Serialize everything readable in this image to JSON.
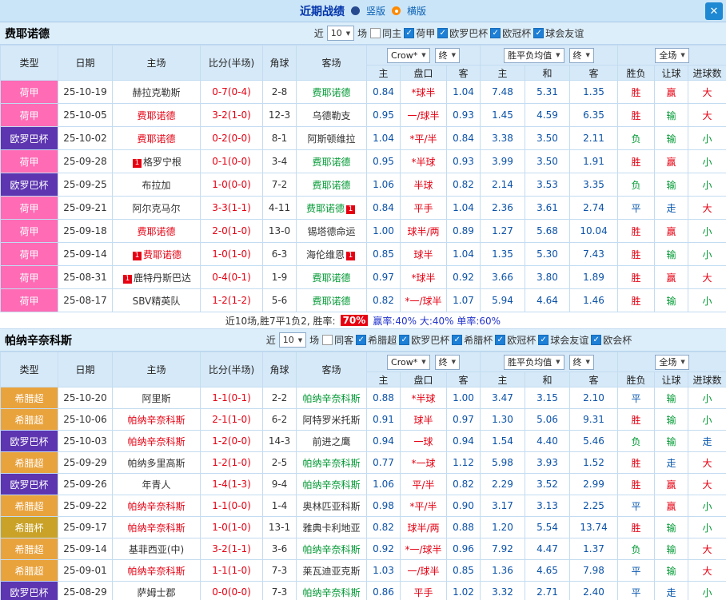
{
  "topbar": {
    "title": "近期战绩",
    "radios": [
      {
        "label": "竖版",
        "selected": false
      },
      {
        "label": "横版",
        "selected": true
      }
    ],
    "close_icon": "✕"
  },
  "table_header": {
    "type": "类型",
    "date": "日期",
    "home": "主场",
    "score": "比分(半场)",
    "corner": "角球",
    "away": "客场",
    "odds_source": "Crow*",
    "odds_time": "终",
    "avg_source": "胜平负均值",
    "avg_time": "终",
    "scope": "全场",
    "sub_home": "主",
    "sub_handicap": "盘口",
    "sub_away": "客",
    "sub_avg_home": "主",
    "sub_avg_draw": "和",
    "sub_avg_away": "客",
    "sub_result": "胜负",
    "sub_handicap_result": "让球",
    "sub_goals": "进球数",
    "dropdown_arrow": "▼"
  },
  "colors": {
    "league_eredivisie": "#ff6bb5",
    "league_europa": "#5d35b0",
    "league_greek_super": "#e9a33d",
    "league_greek_cup": "#c9a227",
    "win_red": "#e60012",
    "lose_green": "#009933",
    "draw_blue": "#0a58b0",
    "odds_blue": "#0b52a8",
    "accent_close": "#1e88d2",
    "selected_radio_orange": "#ff8a00"
  },
  "sections": [
    {
      "team": "费耶诺德",
      "filters": {
        "near": "近",
        "count": "10",
        "games": "场",
        "checkboxes": [
          {
            "label": "同主",
            "checked": false
          },
          {
            "label": "荷甲",
            "checked": true
          },
          {
            "label": "欧罗巴杯",
            "checked": true
          },
          {
            "label": "欧冠杯",
            "checked": true
          },
          {
            "label": "球会友谊",
            "checked": true
          }
        ]
      },
      "rows": [
        {
          "league": "荷甲",
          "lc": "nl",
          "date": "25-10-19",
          "home": {
            "name": "赫拉克勒斯",
            "color": "",
            "pre": "",
            "post": ""
          },
          "score": "0-7(0-4)",
          "corner": "2-8",
          "away": {
            "name": "费耶诺德",
            "color": "green",
            "pre": "",
            "post": ""
          },
          "odds": [
            "0.84",
            "*球半",
            "1.04"
          ],
          "avg": [
            "7.48",
            "5.31",
            "1.35"
          ],
          "res": [
            [
              "胜",
              "r"
            ],
            [
              "赢",
              "r"
            ],
            [
              "大",
              "r"
            ]
          ]
        },
        {
          "league": "荷甲",
          "lc": "nl",
          "date": "25-10-05",
          "home": {
            "name": "费耶诺德",
            "color": "red",
            "pre": "",
            "post": ""
          },
          "score": "3-2(1-0)",
          "corner": "12-3",
          "away": {
            "name": "乌德勒支",
            "color": "",
            "pre": "",
            "post": ""
          },
          "odds": [
            "0.95",
            "一/球半",
            "0.93"
          ],
          "avg": [
            "1.45",
            "4.59",
            "6.35"
          ],
          "res": [
            [
              "胜",
              "r"
            ],
            [
              "输",
              "g"
            ],
            [
              "大",
              "r"
            ]
          ]
        },
        {
          "league": "欧罗巴杯",
          "lc": "uel",
          "date": "25-10-02",
          "home": {
            "name": "费耶诺德",
            "color": "red",
            "pre": "",
            "post": ""
          },
          "score": "0-2(0-0)",
          "corner": "8-1",
          "away": {
            "name": "阿斯顿维拉",
            "color": "",
            "pre": "",
            "post": ""
          },
          "odds": [
            "1.04",
            "*平/半",
            "0.84"
          ],
          "avg": [
            "3.38",
            "3.50",
            "2.11"
          ],
          "res": [
            [
              "负",
              "g"
            ],
            [
              "输",
              "g"
            ],
            [
              "小",
              "g"
            ]
          ]
        },
        {
          "league": "荷甲",
          "lc": "nl",
          "date": "25-09-28",
          "home": {
            "name": "格罗宁根",
            "color": "",
            "pre": "1",
            "post": ""
          },
          "score": "0-1(0-0)",
          "corner": "3-4",
          "away": {
            "name": "费耶诺德",
            "color": "green",
            "pre": "",
            "post": ""
          },
          "odds": [
            "0.95",
            "*半球",
            "0.93"
          ],
          "avg": [
            "3.99",
            "3.50",
            "1.91"
          ],
          "res": [
            [
              "胜",
              "r"
            ],
            [
              "赢",
              "r"
            ],
            [
              "小",
              "g"
            ]
          ]
        },
        {
          "league": "欧罗巴杯",
          "lc": "uel",
          "date": "25-09-25",
          "home": {
            "name": "布拉加",
            "color": "",
            "pre": "",
            "post": ""
          },
          "score": "1-0(0-0)",
          "corner": "7-2",
          "away": {
            "name": "费耶诺德",
            "color": "green",
            "pre": "",
            "post": ""
          },
          "odds": [
            "1.06",
            "半球",
            "0.82"
          ],
          "avg": [
            "2.14",
            "3.53",
            "3.35"
          ],
          "res": [
            [
              "负",
              "g"
            ],
            [
              "输",
              "g"
            ],
            [
              "小",
              "g"
            ]
          ]
        },
        {
          "league": "荷甲",
          "lc": "nl",
          "date": "25-09-21",
          "home": {
            "name": "阿尔克马尔",
            "color": "",
            "pre": "",
            "post": ""
          },
          "score": "3-3(1-1)",
          "corner": "4-11",
          "away": {
            "name": "费耶诺德",
            "color": "green",
            "pre": "",
            "post": "1"
          },
          "odds": [
            "0.84",
            "平手",
            "1.04"
          ],
          "avg": [
            "2.36",
            "3.61",
            "2.74"
          ],
          "res": [
            [
              "平",
              "b"
            ],
            [
              "走",
              "b"
            ],
            [
              "大",
              "r"
            ]
          ]
        },
        {
          "league": "荷甲",
          "lc": "nl",
          "date": "25-09-18",
          "home": {
            "name": "费耶诺德",
            "color": "red",
            "pre": "",
            "post": ""
          },
          "score": "2-0(1-0)",
          "corner": "13-0",
          "away": {
            "name": "锡塔德命运",
            "color": "",
            "pre": "",
            "post": ""
          },
          "odds": [
            "1.00",
            "球半/两",
            "0.89"
          ],
          "avg": [
            "1.27",
            "5.68",
            "10.04"
          ],
          "res": [
            [
              "胜",
              "r"
            ],
            [
              "赢",
              "r"
            ],
            [
              "小",
              "g"
            ]
          ]
        },
        {
          "league": "荷甲",
          "lc": "nl",
          "date": "25-09-14",
          "home": {
            "name": "费耶诺德",
            "color": "red",
            "pre": "1",
            "post": ""
          },
          "score": "1-0(1-0)",
          "corner": "6-3",
          "away": {
            "name": "海伦维恩",
            "color": "",
            "pre": "",
            "post": "1"
          },
          "odds": [
            "0.85",
            "球半",
            "1.04"
          ],
          "avg": [
            "1.35",
            "5.30",
            "7.43"
          ],
          "res": [
            [
              "胜",
              "r"
            ],
            [
              "输",
              "g"
            ],
            [
              "小",
              "g"
            ]
          ]
        },
        {
          "league": "荷甲",
          "lc": "nl",
          "date": "25-08-31",
          "home": {
            "name": "鹿特丹斯巴达",
            "color": "",
            "pre": "1",
            "post": ""
          },
          "score": "0-4(0-1)",
          "corner": "1-9",
          "away": {
            "name": "费耶诺德",
            "color": "green",
            "pre": "",
            "post": ""
          },
          "odds": [
            "0.97",
            "*球半",
            "0.92"
          ],
          "avg": [
            "3.66",
            "3.80",
            "1.89"
          ],
          "res": [
            [
              "胜",
              "r"
            ],
            [
              "赢",
              "r"
            ],
            [
              "大",
              "r"
            ]
          ]
        },
        {
          "league": "荷甲",
          "lc": "nl",
          "date": "25-08-17",
          "home": {
            "name": "SBV精英队",
            "color": "",
            "pre": "",
            "post": ""
          },
          "score": "1-2(1-2)",
          "corner": "5-6",
          "away": {
            "name": "费耶诺德",
            "color": "green",
            "pre": "",
            "post": ""
          },
          "odds": [
            "0.82",
            "*一/球半",
            "1.07"
          ],
          "avg": [
            "5.94",
            "4.64",
            "1.46"
          ],
          "res": [
            [
              "胜",
              "r"
            ],
            [
              "输",
              "g"
            ],
            [
              "小",
              "g"
            ]
          ]
        }
      ],
      "summary": {
        "prefix": "近10场,胜7平1负2, 胜率:",
        "win_rate": "70%",
        "stats": "赢率:40% 大:40% 单率:60%"
      }
    },
    {
      "team": "帕纳辛奈科斯",
      "filters": {
        "near": "近",
        "count": "10",
        "games": "场",
        "checkboxes": [
          {
            "label": "同客",
            "checked": false
          },
          {
            "label": "希腊超",
            "checked": true
          },
          {
            "label": "欧罗巴杯",
            "checked": true
          },
          {
            "label": "希腊杯",
            "checked": true
          },
          {
            "label": "欧冠杯",
            "checked": true
          },
          {
            "label": "球会友谊",
            "checked": true
          },
          {
            "label": "欧会杯",
            "checked": true
          }
        ]
      },
      "rows": [
        {
          "league": "希腊超",
          "lc": "gsl",
          "date": "25-10-20",
          "home": {
            "name": "阿里斯",
            "color": "",
            "pre": "",
            "post": ""
          },
          "score": "1-1(0-1)",
          "corner": "2-2",
          "away": {
            "name": "帕纳辛奈科斯",
            "color": "green",
            "pre": "",
            "post": ""
          },
          "odds": [
            "0.88",
            "*半球",
            "1.00"
          ],
          "avg": [
            "3.47",
            "3.15",
            "2.10"
          ],
          "res": [
            [
              "平",
              "b"
            ],
            [
              "输",
              "g"
            ],
            [
              "小",
              "g"
            ]
          ]
        },
        {
          "league": "希腊超",
          "lc": "gsl",
          "date": "25-10-06",
          "home": {
            "name": "帕纳辛奈科斯",
            "color": "red",
            "pre": "",
            "post": ""
          },
          "score": "2-1(1-0)",
          "corner": "6-2",
          "away": {
            "name": "阿特罗米托斯",
            "color": "",
            "pre": "",
            "post": ""
          },
          "odds": [
            "0.91",
            "球半",
            "0.97"
          ],
          "avg": [
            "1.30",
            "5.06",
            "9.31"
          ],
          "res": [
            [
              "胜",
              "r"
            ],
            [
              "输",
              "g"
            ],
            [
              "小",
              "g"
            ]
          ]
        },
        {
          "league": "欧罗巴杯",
          "lc": "uel",
          "date": "25-10-03",
          "home": {
            "name": "帕纳辛奈科斯",
            "color": "red",
            "pre": "",
            "post": ""
          },
          "score": "1-2(0-0)",
          "corner": "14-3",
          "away": {
            "name": "前进之鹰",
            "color": "",
            "pre": "",
            "post": ""
          },
          "odds": [
            "0.94",
            "一球",
            "0.94"
          ],
          "avg": [
            "1.54",
            "4.40",
            "5.46"
          ],
          "res": [
            [
              "负",
              "g"
            ],
            [
              "输",
              "g"
            ],
            [
              "走",
              "b"
            ]
          ]
        },
        {
          "league": "希腊超",
          "lc": "gsl",
          "date": "25-09-29",
          "home": {
            "name": "帕纳多里高斯",
            "color": "",
            "pre": "",
            "post": ""
          },
          "score": "1-2(1-0)",
          "corner": "2-5",
          "away": {
            "name": "帕纳辛奈科斯",
            "color": "green",
            "pre": "",
            "post": ""
          },
          "odds": [
            "0.77",
            "*一球",
            "1.12"
          ],
          "avg": [
            "5.98",
            "3.93",
            "1.52"
          ],
          "res": [
            [
              "胜",
              "r"
            ],
            [
              "走",
              "b"
            ],
            [
              "大",
              "r"
            ]
          ]
        },
        {
          "league": "欧罗巴杯",
          "lc": "uel",
          "date": "25-09-26",
          "home": {
            "name": "年青人",
            "color": "",
            "pre": "",
            "post": ""
          },
          "score": "1-4(1-3)",
          "corner": "9-4",
          "away": {
            "name": "帕纳辛奈科斯",
            "color": "green",
            "pre": "",
            "post": ""
          },
          "odds": [
            "1.06",
            "平/半",
            "0.82"
          ],
          "avg": [
            "2.29",
            "3.52",
            "2.99"
          ],
          "res": [
            [
              "胜",
              "r"
            ],
            [
              "赢",
              "r"
            ],
            [
              "大",
              "r"
            ]
          ]
        },
        {
          "league": "希腊超",
          "lc": "gsl",
          "date": "25-09-22",
          "home": {
            "name": "帕纳辛奈科斯",
            "color": "red",
            "pre": "",
            "post": ""
          },
          "score": "1-1(0-0)",
          "corner": "1-4",
          "away": {
            "name": "奥林匹亚科斯",
            "color": "",
            "pre": "",
            "post": ""
          },
          "odds": [
            "0.98",
            "*平/半",
            "0.90"
          ],
          "avg": [
            "3.17",
            "3.13",
            "2.25"
          ],
          "res": [
            [
              "平",
              "b"
            ],
            [
              "赢",
              "r"
            ],
            [
              "小",
              "g"
            ]
          ]
        },
        {
          "league": "希腊杯",
          "lc": "gcup",
          "date": "25-09-17",
          "home": {
            "name": "帕纳辛奈科斯",
            "color": "red",
            "pre": "",
            "post": ""
          },
          "score": "1-0(1-0)",
          "corner": "13-1",
          "away": {
            "name": "雅典卡利地亚",
            "color": "",
            "pre": "",
            "post": ""
          },
          "odds": [
            "0.82",
            "球半/两",
            "0.88"
          ],
          "avg": [
            "1.20",
            "5.54",
            "13.74"
          ],
          "res": [
            [
              "胜",
              "r"
            ],
            [
              "输",
              "g"
            ],
            [
              "小",
              "g"
            ]
          ]
        },
        {
          "league": "希腊超",
          "lc": "gsl",
          "date": "25-09-14",
          "home": {
            "name": "基菲西亚(中)",
            "color": "",
            "pre": "",
            "post": ""
          },
          "score": "3-2(1-1)",
          "corner": "3-6",
          "away": {
            "name": "帕纳辛奈科斯",
            "color": "green",
            "pre": "",
            "post": ""
          },
          "odds": [
            "0.92",
            "*一/球半",
            "0.96"
          ],
          "avg": [
            "7.92",
            "4.47",
            "1.37"
          ],
          "res": [
            [
              "负",
              "g"
            ],
            [
              "输",
              "g"
            ],
            [
              "大",
              "r"
            ]
          ]
        },
        {
          "league": "希腊超",
          "lc": "gsl",
          "date": "25-09-01",
          "home": {
            "name": "帕纳辛奈科斯",
            "color": "red",
            "pre": "",
            "post": ""
          },
          "score": "1-1(1-0)",
          "corner": "7-3",
          "away": {
            "name": "莱瓦迪亚克斯",
            "color": "",
            "pre": "",
            "post": ""
          },
          "odds": [
            "1.03",
            "一/球半",
            "0.85"
          ],
          "avg": [
            "1.36",
            "4.65",
            "7.98"
          ],
          "res": [
            [
              "平",
              "b"
            ],
            [
              "输",
              "g"
            ],
            [
              "大",
              "r"
            ]
          ]
        },
        {
          "league": "欧罗巴杯",
          "lc": "uel",
          "date": "25-08-29",
          "home": {
            "name": "萨姆士郡",
            "color": "",
            "pre": "",
            "post": ""
          },
          "score": "0-0(0-0)",
          "corner": "7-3",
          "away": {
            "name": "帕纳辛奈科斯",
            "color": "green",
            "pre": "",
            "post": ""
          },
          "odds": [
            "0.86",
            "平手",
            "1.02"
          ],
          "avg": [
            "3.32",
            "2.71",
            "2.40"
          ],
          "res": [
            [
              "平",
              "b"
            ],
            [
              "走",
              "b"
            ],
            [
              "小",
              "g"
            ]
          ]
        }
      ]
    }
  ]
}
